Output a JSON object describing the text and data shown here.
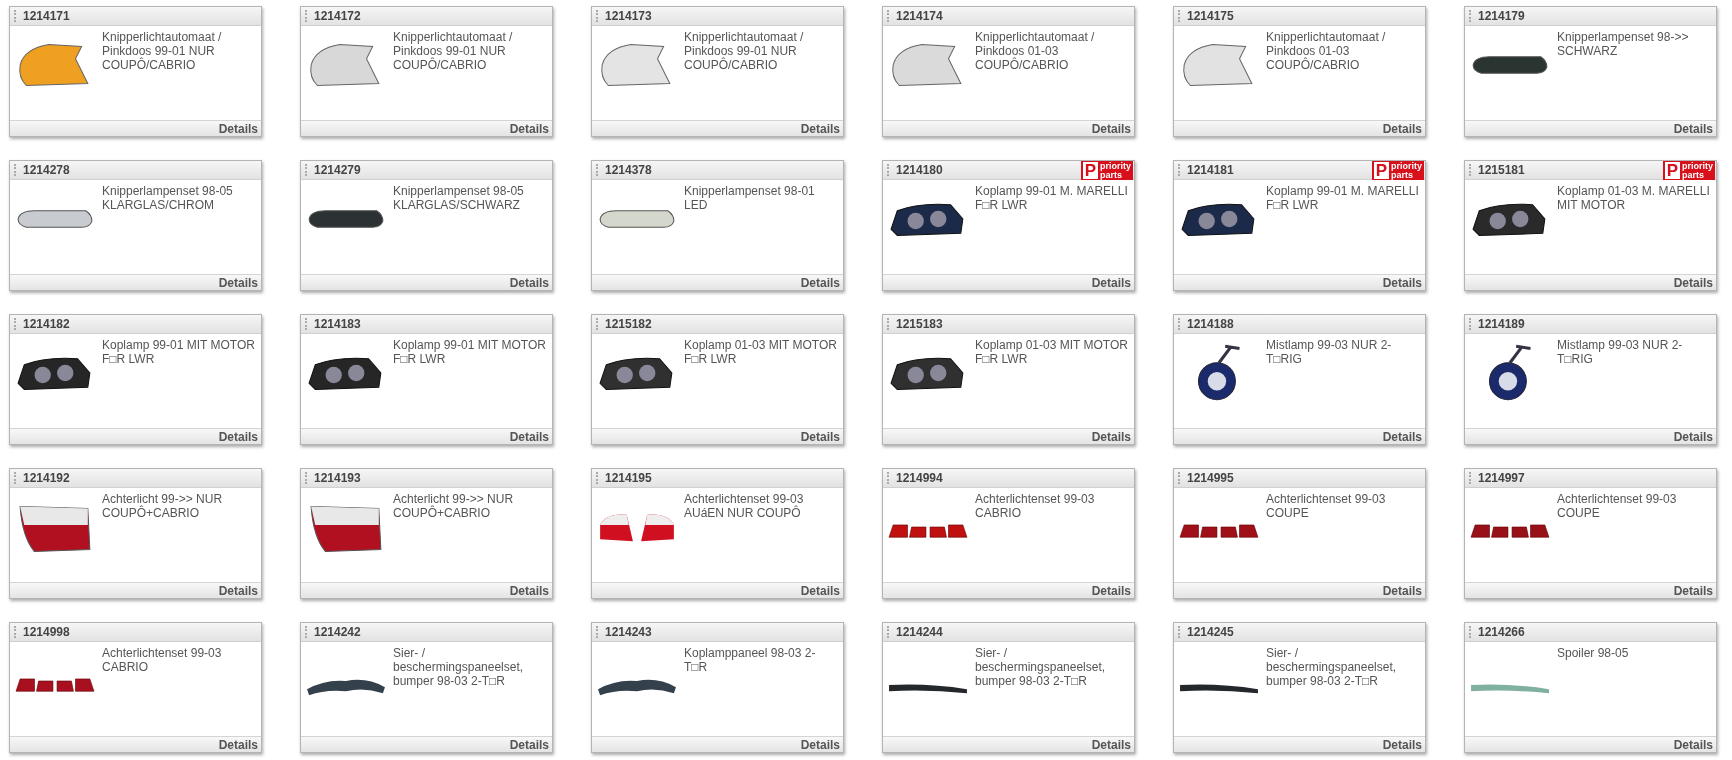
{
  "products": [
    {
      "id": "1214171",
      "description": "Knipperlichtautomaat / Pinkdoos 99-01 NUR COUPÔ/CABRIO",
      "photo": {
        "kind": "corner",
        "color": "#f0a020"
      },
      "details": "Details"
    },
    {
      "id": "1214172",
      "description": "Knipperlichtautomaat / Pinkdoos 99-01 NUR COUPÔ/CABRIO",
      "photo": {
        "kind": "corner",
        "color": "#d8d8d8"
      },
      "details": "Details"
    },
    {
      "id": "1214173",
      "description": "Knipperlichtautomaat / Pinkdoos 99-01 NUR COUPÔ/CABRIO",
      "photo": {
        "kind": "corner",
        "color": "#e4e4e4"
      },
      "details": "Details"
    },
    {
      "id": "1214174",
      "description": "Knipperlichtautomaat / Pinkdoos 01-03 COUPÔ/CABRIO",
      "photo": {
        "kind": "corner",
        "color": "#dadada"
      },
      "details": "Details"
    },
    {
      "id": "1214175",
      "description": "Knipperlichtautomaat / Pinkdoos 01-03 COUPÔ/CABRIO",
      "photo": {
        "kind": "corner",
        "color": "#e2e2e2"
      },
      "details": "Details"
    },
    {
      "id": "1214179",
      "description": "Knipperlampenset 98->> SCHWARZ",
      "photo": {
        "kind": "marker",
        "color": "#2a3430"
      },
      "details": "Details"
    },
    {
      "id": "1214278",
      "description": "Knipperlampenset 98-05 KLARGLAS/CHROM",
      "photo": {
        "kind": "marker",
        "color": "#c8ccd0"
      },
      "details": "Details"
    },
    {
      "id": "1214279",
      "description": "Knipperlampenset 98-05 KLARGLAS/SCHWARZ",
      "photo": {
        "kind": "marker",
        "color": "#2c3234"
      },
      "details": "Details"
    },
    {
      "id": "1214378",
      "description": "Knipperlampenset 98-01 LED",
      "photo": {
        "kind": "marker",
        "color": "#d4d8cc"
      },
      "details": "Details"
    },
    {
      "id": "1214180",
      "badge": {
        "letter": "P",
        "top": "priority",
        "bottom": "parts"
      },
      "description": "Koplamp 99-01 M. MARELLI F□R LWR",
      "photo": {
        "kind": "headlamp",
        "color": "#1c2a4a"
      },
      "details": "Details"
    },
    {
      "id": "1214181",
      "badge": {
        "letter": "P",
        "top": "priority",
        "bottom": "parts"
      },
      "description": "Koplamp 99-01 M. MARELLI F□R LWR",
      "photo": {
        "kind": "headlamp",
        "color": "#1c2a4a"
      },
      "details": "Details"
    },
    {
      "id": "1215181",
      "badge": {
        "letter": "P",
        "top": "priority",
        "bottom": "parts"
      },
      "description": "Koplamp 01-03 M. MARELLI MIT MOTOR",
      "photo": {
        "kind": "headlamp",
        "color": "#2a2a2a"
      },
      "details": "Details"
    },
    {
      "id": "1214182",
      "description": "Koplamp 99-01 MIT MOTOR F□R LWR",
      "photo": {
        "kind": "headlamp",
        "color": "#262626"
      },
      "details": "Details"
    },
    {
      "id": "1214183",
      "description": "Koplamp 99-01 MIT MOTOR F□R LWR",
      "photo": {
        "kind": "headlamp",
        "color": "#262626"
      },
      "details": "Details"
    },
    {
      "id": "1215182",
      "description": "Koplamp 01-03 MIT MOTOR F□R LWR",
      "photo": {
        "kind": "headlamp",
        "color": "#303030"
      },
      "details": "Details"
    },
    {
      "id": "1215183",
      "description": "Koplamp 01-03 MIT MOTOR F□R LWR",
      "photo": {
        "kind": "headlamp",
        "color": "#303030"
      },
      "details": "Details"
    },
    {
      "id": "1214188",
      "description": "Mistlamp 99-03 NUR 2-T□RIG",
      "photo": {
        "kind": "foglamp",
        "color": "#1a2a6a"
      },
      "details": "Details"
    },
    {
      "id": "1214189",
      "description": "Mistlamp 99-03 NUR 2-T□RIG",
      "photo": {
        "kind": "foglamp",
        "color": "#1a2a6a"
      },
      "details": "Details"
    },
    {
      "id": "1214192",
      "description": "Achterlicht 99->> NUR COUPÔ+CABRIO",
      "photo": {
        "kind": "taillight",
        "color": "#b01020"
      },
      "details": "Details"
    },
    {
      "id": "1214193",
      "description": "Achterlicht 99->> NUR COUPÔ+CABRIO",
      "photo": {
        "kind": "taillight",
        "color": "#b01020"
      },
      "details": "Details"
    },
    {
      "id": "1214195",
      "description": "Achterlichtenset 99-03 AUáEN NUR COUPÔ",
      "photo": {
        "kind": "tailpair",
        "color": "#d01020"
      },
      "details": "Details"
    },
    {
      "id": "1214994",
      "description": "Achterlichtenset 99-03 CABRIO",
      "photo": {
        "kind": "tailset",
        "color": "#c01010"
      },
      "details": "Details"
    },
    {
      "id": "1214995",
      "description": "Achterlichtenset 99-03 COUPE",
      "photo": {
        "kind": "tailset",
        "color": "#a01018"
      },
      "details": "Details"
    },
    {
      "id": "1214997",
      "description": "Achterlichtenset 99-03 COUPE",
      "photo": {
        "kind": "tailset",
        "color": "#981018"
      },
      "details": "Details"
    },
    {
      "id": "1214998",
      "description": "Achterlichtenset 99-03 CABRIO",
      "photo": {
        "kind": "tailset",
        "color": "#a81020"
      },
      "details": "Details"
    },
    {
      "id": "1214242",
      "description": "Sier- / beschermingspaneelset, bumper 98-03 2-T□R",
      "photo": {
        "kind": "panel",
        "color": "#34404c"
      },
      "details": "Details"
    },
    {
      "id": "1214243",
      "description": "Koplamppaneel 98-03 2-T□R",
      "photo": {
        "kind": "panel",
        "color": "#34404c"
      },
      "details": "Details"
    },
    {
      "id": "1214244",
      "description": "Sier- / beschermingspaneelset, bumper 98-03 2-T□R",
      "photo": {
        "kind": "strip",
        "color": "#24282c"
      },
      "details": "Details"
    },
    {
      "id": "1214245",
      "description": "Sier- / beschermingspaneelset, bumper 98-03 2-T□R",
      "photo": {
        "kind": "strip",
        "color": "#24282c"
      },
      "details": "Details"
    },
    {
      "id": "1214266",
      "description": "Spoiler 98-05",
      "photo": {
        "kind": "strip",
        "color": "#80b0a0"
      },
      "details": "Details"
    }
  ]
}
